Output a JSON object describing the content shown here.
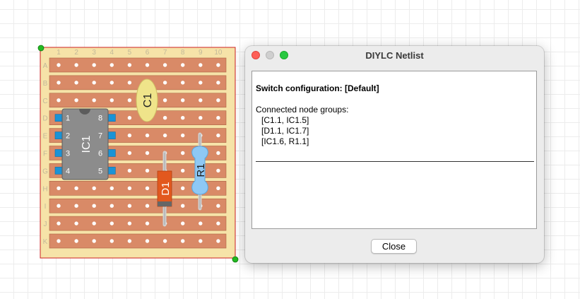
{
  "board": {
    "columns": [
      "1",
      "2",
      "3",
      "4",
      "5",
      "6",
      "7",
      "8",
      "9",
      "10"
    ],
    "rows": [
      "A",
      "B",
      "C",
      "D",
      "E",
      "F",
      "G",
      "H",
      "I",
      "J",
      "K"
    ]
  },
  "components": {
    "ic": {
      "label": "IC1",
      "pins_left": [
        "1",
        "2",
        "3",
        "4"
      ],
      "pins_right": [
        "8",
        "7",
        "6",
        "5"
      ]
    },
    "capacitor": {
      "label": "C1"
    },
    "diode": {
      "label": "D1"
    },
    "resistor": {
      "label": "R1"
    }
  },
  "colors": {
    "board": "#f6e3a8",
    "strip": "#d98a67",
    "capacitor": "#efe48a",
    "diode": "#e2581e",
    "resistor": "#8ec8f5",
    "ic_body": "#8c8c8c",
    "ic_pin": "#1a93d6",
    "selection": "#cc2222",
    "handle": "#22bb22"
  },
  "dialog": {
    "title": "DIYLC Netlist",
    "switch_config": "Switch configuration: [Default]",
    "groups_label": "Connected node groups:",
    "groups": [
      "[C1.1, IC1.5]",
      "[D1.1, IC1.7]",
      "[IC1.6, R1.1]"
    ],
    "close_label": "Close"
  }
}
